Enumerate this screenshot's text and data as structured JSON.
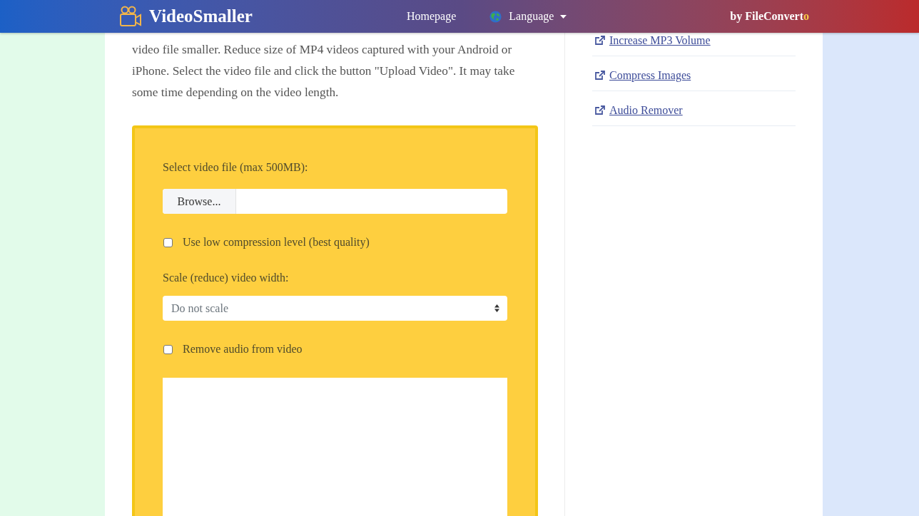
{
  "header": {
    "logo": "VideoSmaller",
    "nav": [
      {
        "kind": "link",
        "label": "Homepage"
      },
      {
        "kind": "menu",
        "label": "Language"
      }
    ],
    "brand": {
      "text": "by FileConvert",
      "accent": "o"
    }
  },
  "intro": "video file smaller. Reduce size of MP4 videos captured with your Android or iPhone. Select the video file and click the button \"Upload Video\". It may take some time depending on the video length.",
  "form": {
    "file_label": "Select video file (max 500MB):",
    "browse_button": "Browse...",
    "options": [
      {
        "kind": "checkbox",
        "label": "Use low compression level (best quality)",
        "checked": false
      },
      {
        "kind": "select",
        "label": "Scale (reduce) video width:",
        "value": "Do not scale"
      },
      {
        "kind": "checkbox",
        "label": "Remove audio from video",
        "checked": false
      }
    ]
  },
  "sidebar": {
    "links": [
      "Increase MP3 Volume",
      "Compress Images",
      "Audio Remover"
    ]
  }
}
